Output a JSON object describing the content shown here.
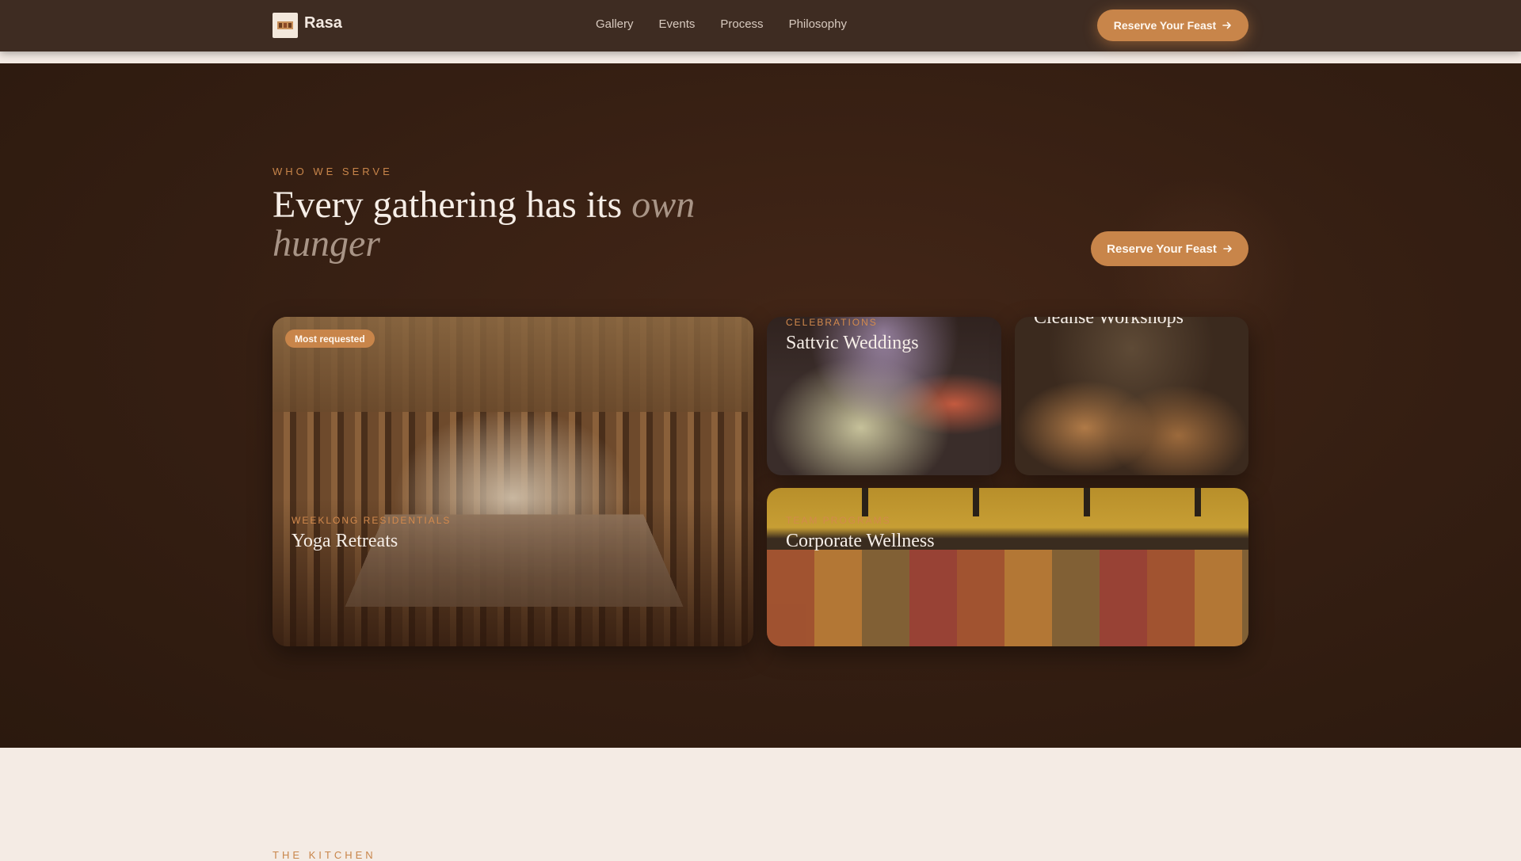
{
  "brand": {
    "name": "Rasa",
    "logo_icon": "mandala-logo-icon"
  },
  "nav": {
    "links": [
      "Gallery",
      "Events",
      "Process",
      "Philosophy"
    ],
    "cta_label": "Reserve Your Feast",
    "cta_icon": "arrow-right-icon"
  },
  "section": {
    "eyebrow": "WHO WE SERVE",
    "headline_main": "Every gathering has its ",
    "headline_accent": "own hunger",
    "cta_label": "Reserve Your Feast",
    "cards": [
      {
        "badge": "Most requested",
        "kicker": "WEEKLONG RESIDENTIALS",
        "title": "Yoga Retreats"
      },
      {
        "kicker": "CELEBRATIONS",
        "title": "Sattvic Weddings"
      },
      {
        "kicker": "",
        "title": "Cleanse Workshops"
      },
      {
        "kicker": "TEAM PROGRAMS",
        "title": "Corporate Wellness"
      }
    ]
  },
  "next_section": {
    "eyebrow": "THE KITCHEN"
  },
  "colors": {
    "accent": "#c8854a",
    "nav_bg": "#3e2c22",
    "section_bg": "#341e12",
    "page_bg": "#f4ebe4"
  }
}
